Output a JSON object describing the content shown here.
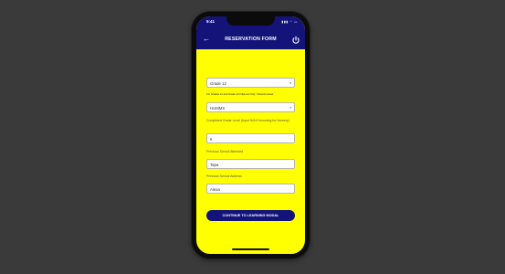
{
  "status_bar": {
    "time": "9:41",
    "icons": "▮▮▮ ◠ ▭"
  },
  "app_bar": {
    "back_icon": "arrow-left-icon",
    "title": "RESERVATION FORM",
    "power_icon": "power-icon"
  },
  "form": {
    "grade_select": {
      "value": "Grade 12"
    },
    "grade_note": "For Grades 11 and Grade 12 Filipinos Only / Strands below",
    "strand_select": {
      "value": "HUMMS"
    },
    "completed_grade_label": "Completed Grade Level (Input N/A if Incoming for Nursery)",
    "completed_grade_value": "6",
    "previous_school_label": "Previous School Attended",
    "previous_school_value": "Tapa",
    "previous_address_label": "Previous School Address",
    "previous_address_value": "Alexa",
    "continue_button": "CONTINUE TO LEARNING MODAL"
  },
  "colors": {
    "primary": "#13137a",
    "background": "#ffff00",
    "backdrop": "#3a3a3a"
  }
}
